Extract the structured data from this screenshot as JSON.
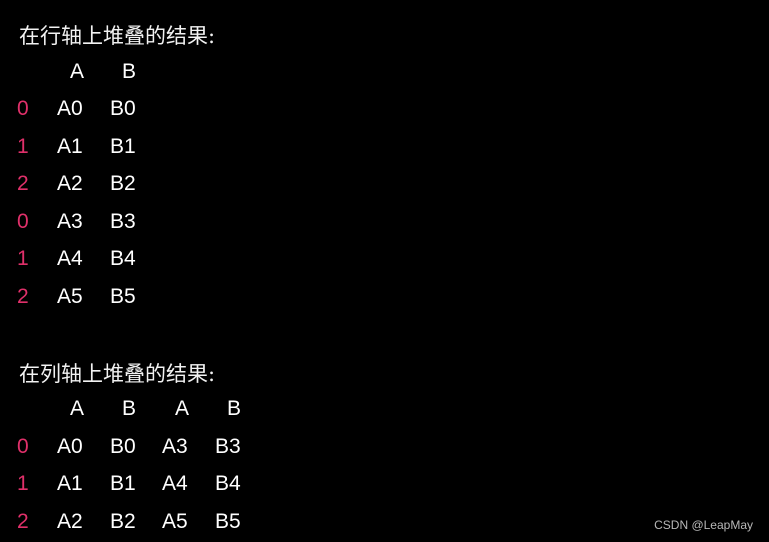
{
  "section1": {
    "title": "在行轴上堆叠的结果:",
    "columns": [
      "A",
      "B"
    ],
    "rows": [
      {
        "index": "0",
        "cells": [
          "A0",
          "B0"
        ]
      },
      {
        "index": "1",
        "cells": [
          "A1",
          "B1"
        ]
      },
      {
        "index": "2",
        "cells": [
          "A2",
          "B2"
        ]
      },
      {
        "index": "0",
        "cells": [
          "A3",
          "B3"
        ]
      },
      {
        "index": "1",
        "cells": [
          "A4",
          "B4"
        ]
      },
      {
        "index": "2",
        "cells": [
          "A5",
          "B5"
        ]
      }
    ]
  },
  "section2": {
    "title": "在列轴上堆叠的结果:",
    "columns": [
      "A",
      "B",
      "A",
      "B"
    ],
    "rows": [
      {
        "index": "0",
        "cells": [
          "A0",
          "B0",
          "A3",
          "B3"
        ]
      },
      {
        "index": "1",
        "cells": [
          "A1",
          "B1",
          "A4",
          "B4"
        ]
      },
      {
        "index": "2",
        "cells": [
          "A2",
          "B2",
          "A5",
          "B5"
        ]
      }
    ]
  },
  "watermark": "CSDN @LeapMay",
  "colors": {
    "index": "#e0306a",
    "text": "#ffffff",
    "background": "#000000"
  }
}
